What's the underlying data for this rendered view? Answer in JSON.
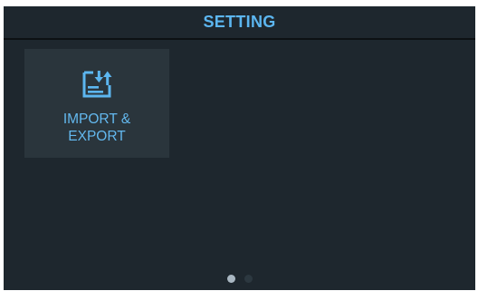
{
  "header": {
    "title": "SETTING"
  },
  "tiles": [
    {
      "label": "IMPORT &\nEXPORT",
      "icon": "import-export-icon"
    }
  ],
  "pager": {
    "page_count": 2,
    "current_page": 1
  },
  "colors": {
    "background": "#1e272e",
    "tile": "#2a353c",
    "accent": "#5cb6f0",
    "dot_active": "#a9b7c2",
    "dot_inactive": "#2c3840"
  }
}
